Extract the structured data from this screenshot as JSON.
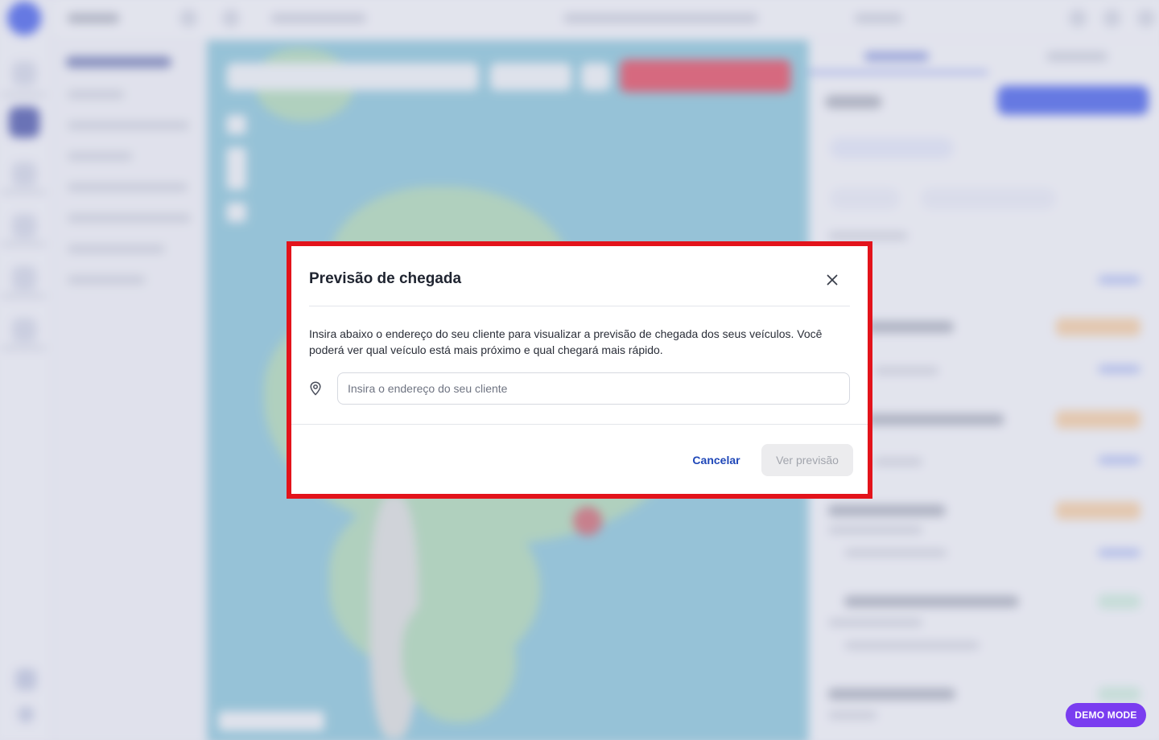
{
  "modal": {
    "title": "Previsão de chegada",
    "description": "Insira abaixo o endereço do seu cliente para visualizar a previsão de chegada dos seus veículos. Você poderá ver qual veículo está mais próximo e qual chegará mais rápido.",
    "address_input": {
      "value": "",
      "placeholder": "Insira o endereço do seu cliente"
    },
    "cancel_label": "Cancelar",
    "submit_label": "Ver previsão",
    "submit_disabled": true
  },
  "demo_badge": "DEMO MODE",
  "icons": {
    "close": "close-icon",
    "address": "map-pin-icon"
  },
  "colors": {
    "highlight_frame": "#e3131b",
    "primary_link": "#1f47b8",
    "brand": "#1f3fe6",
    "demo_badge": "#7a3df0",
    "disabled_button": "#ececee"
  }
}
